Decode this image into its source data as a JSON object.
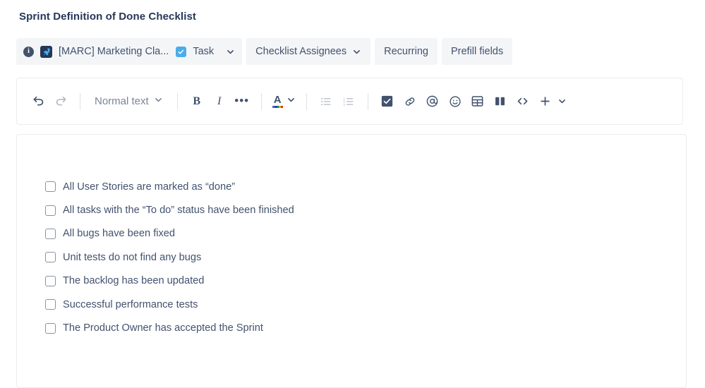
{
  "page_title": "Sprint Definition of Done Checklist",
  "header": {
    "info_glyph": "i",
    "project_name": "[MARC] Marketing Cla...",
    "issue_type": "Task",
    "assignees_button": "Checklist Assignees",
    "recurring_button": "Recurring",
    "prefill_button": "Prefill fields"
  },
  "toolbar": {
    "undo": "undo-icon",
    "redo": "redo-icon",
    "text_style": "Normal text",
    "bold": "B",
    "italic": "I",
    "more_formatting": "•••",
    "text_color_glyph": "A",
    "text_color_swatches": [
      "#6554c0",
      "#0052cc",
      "#00875a",
      "#ff991f",
      "#de350b"
    ],
    "bullet_list": "bullet-list-icon",
    "numbered_list": "numbered-list-icon",
    "action_item": "checkbox-icon",
    "link": "link-icon",
    "mention": "@",
    "emoji": "emoji-icon",
    "table": "table-icon",
    "layout": "layout-columns-icon",
    "code": "<>",
    "insert": "+"
  },
  "checklist": {
    "items": [
      {
        "label": "All User Stories are marked as “done”",
        "checked": false
      },
      {
        "label": "All tasks with the “To do” status have been finished",
        "checked": false
      },
      {
        "label": "All bugs have been fixed",
        "checked": false
      },
      {
        "label": "Unit tests do not find any bugs",
        "checked": false
      },
      {
        "label": "The backlog has been updated",
        "checked": false
      },
      {
        "label": "Successful performance tests",
        "checked": false
      },
      {
        "label": "The Product Owner has accepted the Sprint",
        "checked": false
      }
    ]
  },
  "colors": {
    "text_primary": "#253858",
    "text_secondary": "#42526e",
    "muted": "#7a869a",
    "pill_bg": "#f4f5f7",
    "border": "#ebecf0",
    "task_blue": "#4bade8",
    "rocket_navy": "#243757"
  }
}
